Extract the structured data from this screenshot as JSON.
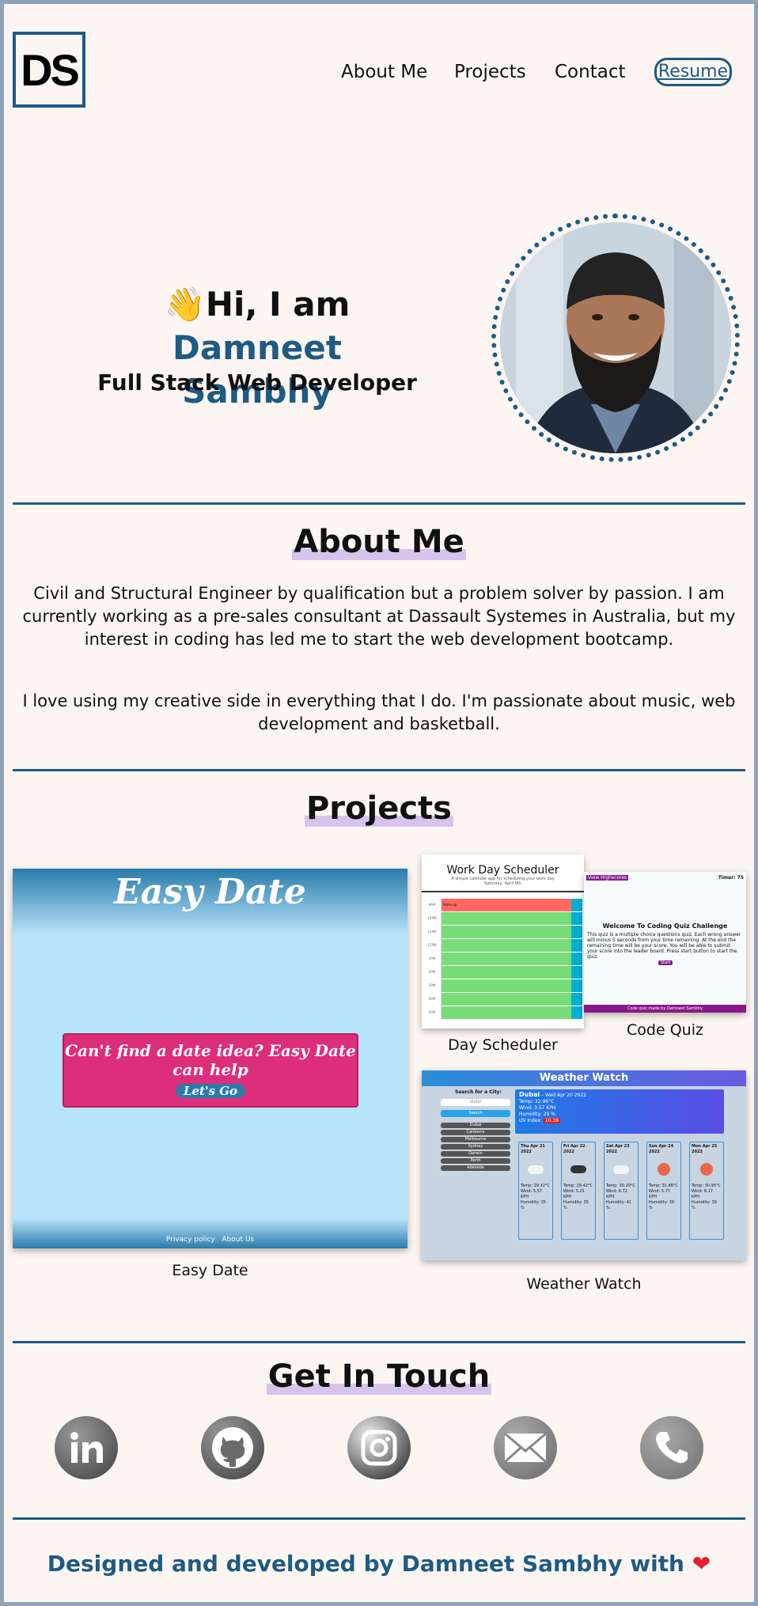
{
  "header": {
    "logo": "DS",
    "nav": [
      {
        "label": "About Me"
      },
      {
        "label": "Projects"
      },
      {
        "label": "Contact"
      }
    ],
    "resume_label": "Resume"
  },
  "hero": {
    "greeting_emoji": "👋",
    "greeting": "Hi, I am ",
    "name_first": "Damneet",
    "name_last": "Sambhy",
    "subtitle": "Full Stack Web Developer"
  },
  "about": {
    "title": "About Me",
    "paragraphs": [
      "Civil and Structural Engineer by qualification but a problem solver by passion. I am currently working as a pre-sales consultant at Dassault Systemes in Australia, but my interest in coding has led me to start the web development bootcamp.",
      "I love using my creative side in everything that I do. I'm passionate about music, web development and basketball."
    ]
  },
  "projects": {
    "title": "Projects",
    "items": [
      {
        "caption": "Easy Date",
        "screen_title": "Easy Date",
        "card_text": "Can't find a date idea? Easy Date can help",
        "button": "Let's Go",
        "footer_links": [
          "Privacy policy",
          "About Us"
        ]
      },
      {
        "caption": "Day Scheduler",
        "screen_title": "Work Day Scheduler",
        "screen_sub": "A simple calendar app for scheduling your work day",
        "screen_date": "Saturday, April 9th",
        "hours": [
          "9AM",
          "10AM",
          "11AM",
          "12PM",
          "1PM",
          "2PM",
          "3PM",
          "4PM",
          "5PM"
        ],
        "tasks": [
          "Wake up",
          "",
          "",
          "",
          "",
          "",
          "",
          "",
          ""
        ],
        "current_hour_index": 0
      },
      {
        "caption": "Code Quiz",
        "highscores": "View Highscores",
        "timer": "Timer: 75",
        "heading": "Welcome To Coding Quiz Challenge",
        "body": "This quiz is a multiple choice questions quiz. Each wrong answer will minus 5 seconds from your time remaining. At the end the remaining time will be your score. You will be able to submit your score into the leader board. Press start button to start the quiz.",
        "start": "Start",
        "footer": "Code quiz made by Damneet Sambhy"
      },
      {
        "caption": "Weather Watch",
        "screen_title": "Weather Watch",
        "search_label": "Search for a City:",
        "search_placeholder": "dubai",
        "search_button": "Search",
        "cities": [
          "Dubai",
          "Canberra",
          "Melbourne",
          "Sydney",
          "Darwin",
          "Perth",
          "Adelaide"
        ],
        "current": {
          "city": "Dubai",
          "date": "Wed Apr 20 2022",
          "temp": "Temp: 32.96°C",
          "wind": "Wind: 3.57 KPH",
          "humidity": "Humidity: 29 %",
          "uv_label": "UV Index:",
          "uv_value": "10.38"
        },
        "forecast": [
          {
            "date": "Thu Apr 21 2022",
            "icon": "cloud-icon",
            "temp": "Temp: 29.32°C",
            "wind": "Wind: 5.57 KPH",
            "humidity": "Humidity: 35 %"
          },
          {
            "date": "Fri Apr 22 2022",
            "icon": "cloud-dark-icon",
            "temp": "Temp: 29.42°C",
            "wind": "Wind: 5.21 KPH",
            "humidity": "Humidity: 35 %"
          },
          {
            "date": "Sat Apr 23 2022",
            "icon": "cloud-icon",
            "temp": "Temp: 30.29°C",
            "wind": "Wind: 6.72 KPH",
            "humidity": "Humidity: 41 %"
          },
          {
            "date": "Sun Apr 24 2022",
            "icon": "sun-icon",
            "temp": "Temp: 31.88°C",
            "wind": "Wind: 5.77 KPH",
            "humidity": "Humidity: 39 %"
          },
          {
            "date": "Mon Apr 25 2022",
            "icon": "sun-icon",
            "temp": "Temp: 30.95°C",
            "wind": "Wind: 8.17 KPH",
            "humidity": "Humidity: 30 %"
          }
        ]
      }
    ]
  },
  "contact": {
    "title": "Get In Touch",
    "icons": [
      "linkedin-icon",
      "github-icon",
      "instagram-icon",
      "email-icon",
      "phone-icon"
    ]
  },
  "footer": {
    "text": "Designed and developed by Damneet Sambhy with",
    "heart": "❤"
  },
  "colors": {
    "accent": "#1d5b83",
    "background": "#fdf5f1",
    "highlight": "#d6c4ec",
    "heart": "#e0202a"
  }
}
